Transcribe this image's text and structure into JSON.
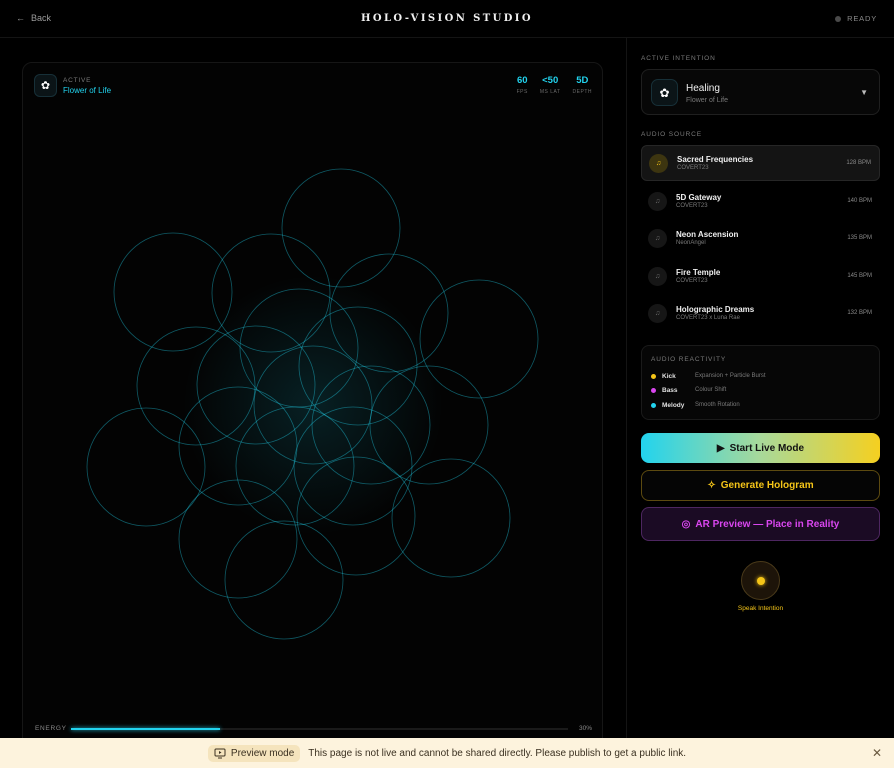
{
  "header": {
    "back_label": "Back",
    "back_icon": "arrow-left-icon",
    "title": "HOLO-VISION STUDIO",
    "status": "READY"
  },
  "stage": {
    "active_label": "ACTIVE",
    "pattern_name": "Flower of Life",
    "stats": [
      {
        "value": "60",
        "label": "FPS"
      },
      {
        "value": "<50",
        "label": "MS LAT"
      },
      {
        "value": "5D",
        "label": "DEPTH"
      }
    ],
    "energy_label": "ENERGY",
    "energy_text": "30%",
    "energy_fraction": 0.3,
    "hologram_color": "#22d3ee"
  },
  "intention": {
    "section_title": "ACTIVE INTENTION",
    "name": "Healing",
    "pattern": "Flower of Life",
    "icon": "flower-icon"
  },
  "audio": {
    "section_title": "AUDIO SOURCE",
    "tracks": [
      {
        "name": "Sacred Frequencies",
        "artist": "COVERT23",
        "bpm": "128 BPM",
        "selected": true
      },
      {
        "name": "5D Gateway",
        "artist": "COVERT23",
        "bpm": "140 BPM",
        "selected": false
      },
      {
        "name": "Neon Ascension",
        "artist": "NeonAngel",
        "bpm": "135 BPM",
        "selected": false
      },
      {
        "name": "Fire Temple",
        "artist": "COVERT23",
        "bpm": "145 BPM",
        "selected": false
      },
      {
        "name": "Holographic Dreams",
        "artist": "COVERT23 x Luna Rae",
        "bpm": "132 BPM",
        "selected": false
      }
    ]
  },
  "reactivity": {
    "section_title": "AUDIO REACTIVITY",
    "rows": [
      {
        "name": "Kick",
        "desc": "Expansion + Particle Burst",
        "color": "#f5c518"
      },
      {
        "name": "Bass",
        "desc": "Colour Shift",
        "color": "#d946ef"
      },
      {
        "name": "Melody",
        "desc": "Smooth Rotation",
        "color": "#22d3ee"
      }
    ]
  },
  "actions": {
    "live_label": "Start Live Mode",
    "generate_label": "Generate Hologram",
    "ar_label": "AR Preview — Place in Reality",
    "speak_label": "Speak Intention"
  },
  "banner": {
    "mode_label": "Preview mode",
    "message": "This page is not live and cannot be shared directly. Please publish to get a public link.",
    "close_icon": "close-icon"
  }
}
